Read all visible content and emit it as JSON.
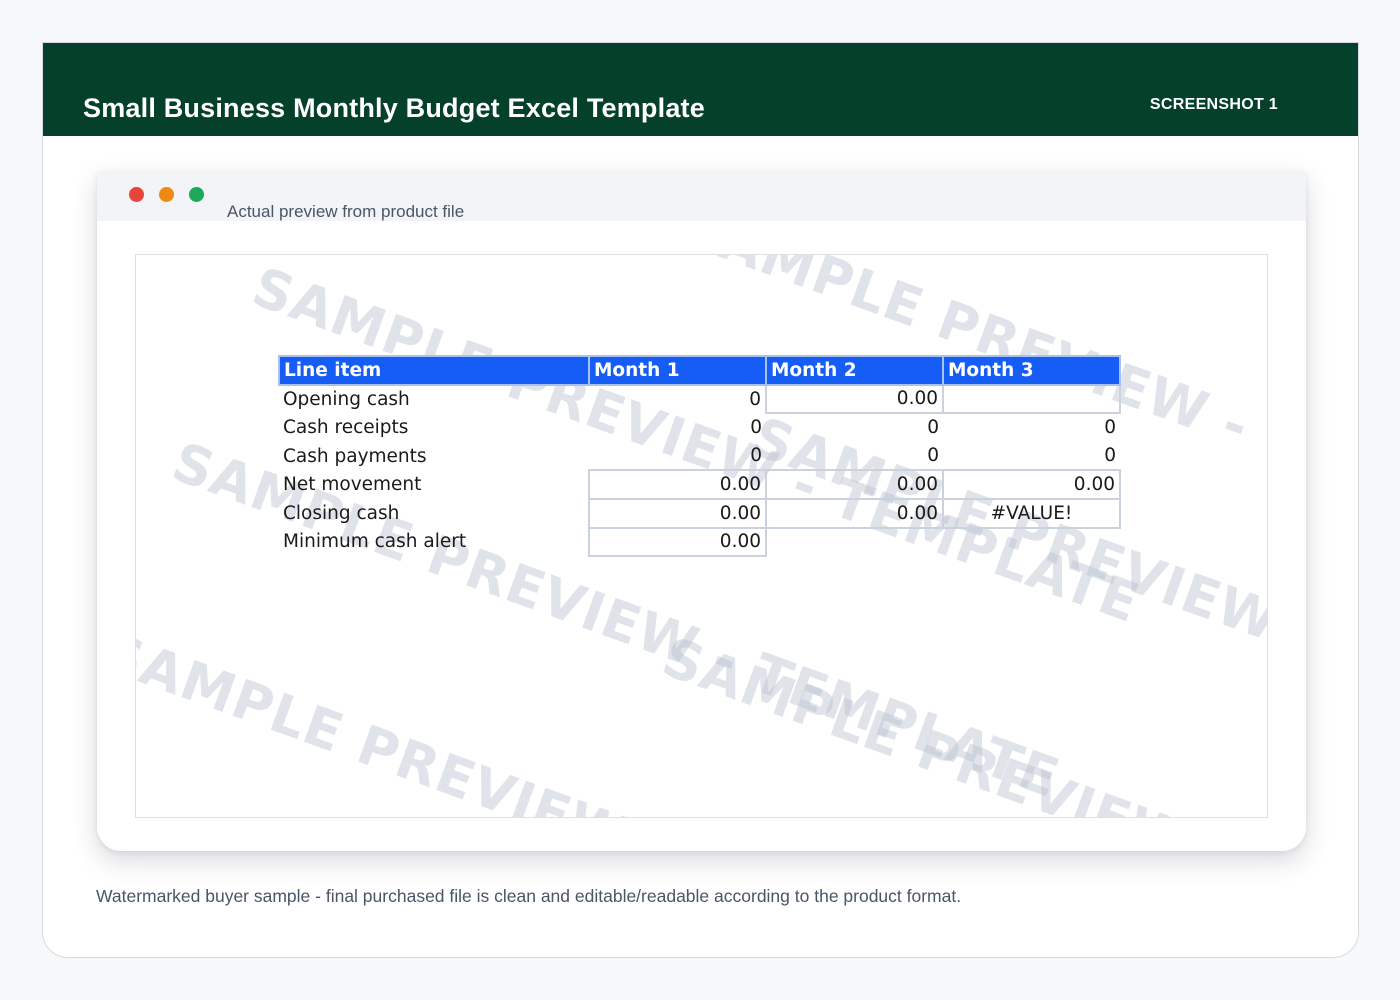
{
  "header": {
    "title": "Small Business Monthly Budget Excel Template",
    "tag": "SCREENSHOT 1"
  },
  "window": {
    "caption": "Actual preview from product file"
  },
  "sheet": {
    "columns": [
      "Line item",
      "Month 1",
      "Month 2",
      "Month 3"
    ],
    "rows": [
      {
        "label": "Opening cash",
        "m1": "0",
        "m2": "0.00",
        "m3": ""
      },
      {
        "label": "Cash receipts",
        "m1": "0",
        "m2": "0",
        "m3": "0"
      },
      {
        "label": "Cash payments",
        "m1": "0",
        "m2": "0",
        "m3": "0"
      },
      {
        "label": "Net movement",
        "m1": "0.00",
        "m2": "0.00",
        "m3": "0.00"
      },
      {
        "label": "Closing cash",
        "m1": "0.00",
        "m2": "0.00",
        "m3": "#VALUE!"
      },
      {
        "label": "Minimum cash alert",
        "m1": "0.00",
        "m2": "",
        "m3": ""
      }
    ]
  },
  "watermark": {
    "text": "SAMPLE PREVIEW - TEMPLATE"
  },
  "footer": {
    "caption": "Watermarked buyer sample - final purchased file is clean and editable/readable according to the product format."
  },
  "colors": {
    "header_bg": "#05402a",
    "table_header_bg": "#155df5",
    "dot_red": "#e5453a",
    "dot_orange": "#ee8a12",
    "dot_green": "#1caa5a"
  }
}
